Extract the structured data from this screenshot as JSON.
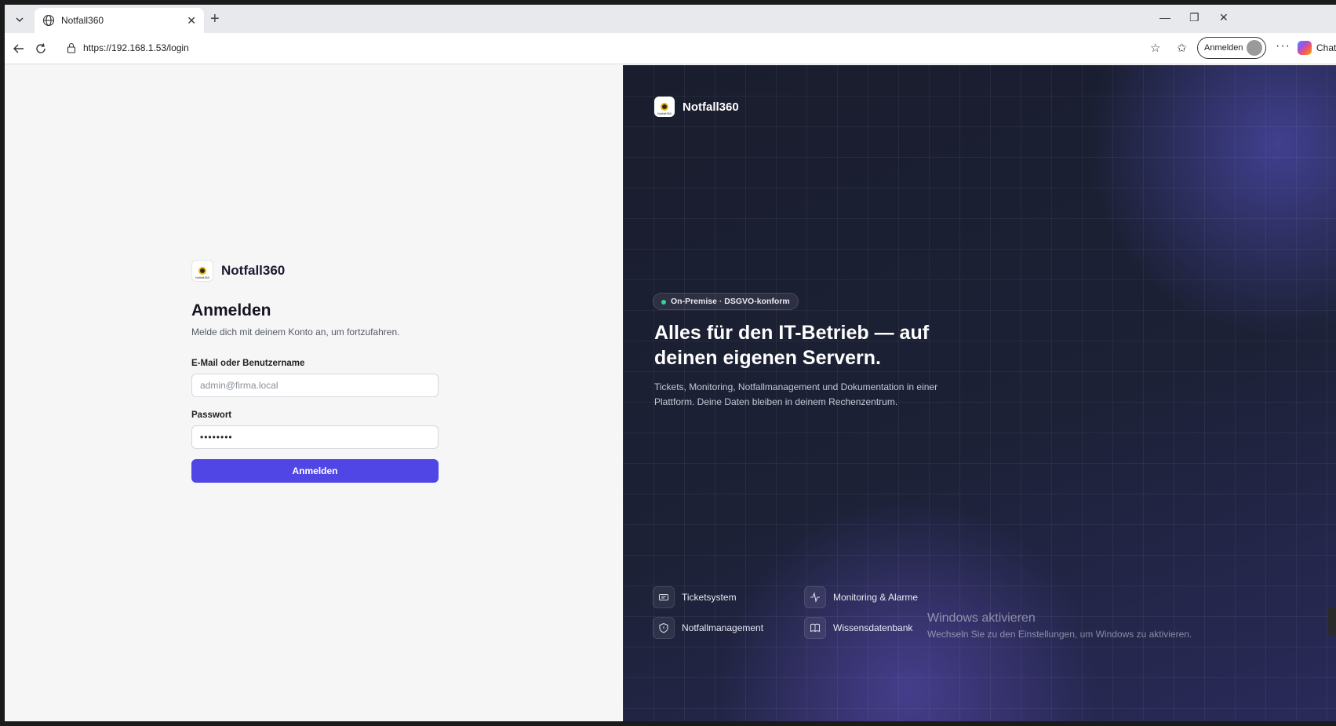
{
  "browser": {
    "tab_title": "Notfall360",
    "url": "https://192.168.1.53/login",
    "profile_label": "Anmelden",
    "chat_label": "Chat"
  },
  "login": {
    "brand": "Notfall360",
    "heading": "Anmelden",
    "subtitle": "Melde dich mit deinem Konto an, um fortzufahren.",
    "email_label": "E-Mail oder Benutzername",
    "email_placeholder": "admin@firma.local",
    "password_label": "Passwort",
    "password_value": "••••••••",
    "submit_label": "Anmelden"
  },
  "hero": {
    "brand": "Notfall360",
    "badge": "On-Premise · DSGVO-konform",
    "headline": "Alles für den IT-Betrieb — auf deinen eigenen Servern.",
    "description": "Tickets, Monitoring, Notfallmanagement und Dokumentation in einer Plattform. Deine Daten bleiben in deinem Rechenzentrum.",
    "features": [
      {
        "label": "Ticketsystem",
        "icon": "ticket-icon"
      },
      {
        "label": "Monitoring & Alarme",
        "icon": "activity-icon"
      },
      {
        "label": "Notfallmanagement",
        "icon": "shield-icon"
      },
      {
        "label": "Wissensdatenbank",
        "icon": "book-icon"
      }
    ]
  },
  "watermark": {
    "title": "Windows aktivieren",
    "text": "Wechseln Sie zu den Einstellungen, um Windows zu aktivieren."
  },
  "colors": {
    "accent": "#4f46e5",
    "panel_bg": "#1c2136",
    "status_green": "#34d399"
  }
}
